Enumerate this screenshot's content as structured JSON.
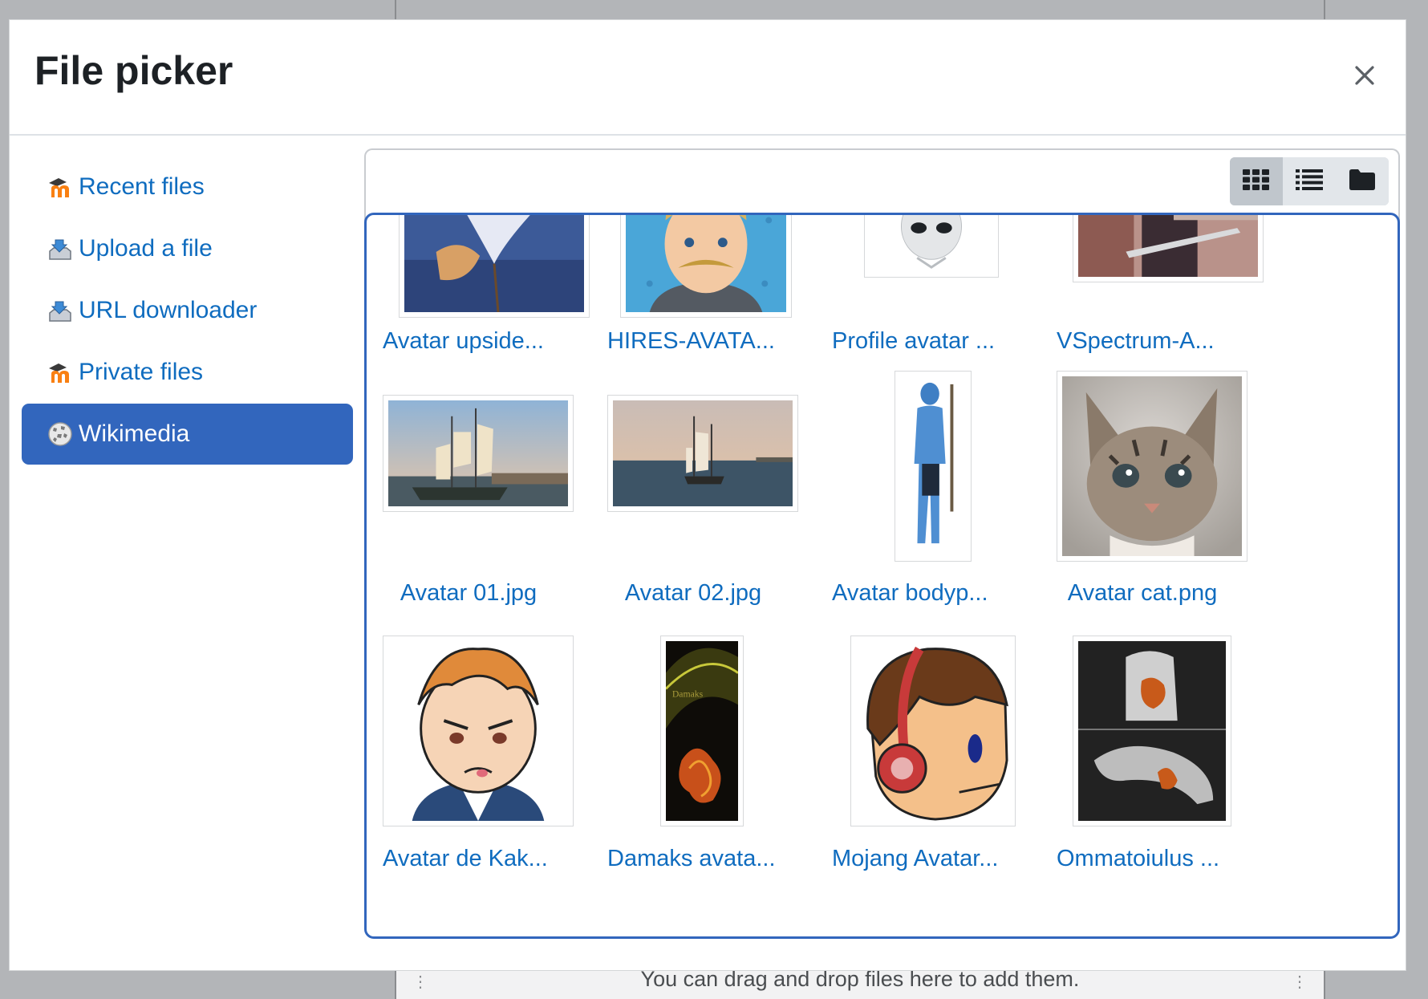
{
  "dialog": {
    "title": "File picker",
    "close_icon": "close-icon"
  },
  "sidebar": {
    "items": [
      {
        "label": "Recent files",
        "icon": "moodle-icon",
        "active": false
      },
      {
        "label": "Upload a file",
        "icon": "upload-icon",
        "active": false
      },
      {
        "label": "URL downloader",
        "icon": "download-icon",
        "active": false
      },
      {
        "label": "Private files",
        "icon": "moodle-icon",
        "active": false
      },
      {
        "label": "Wikimedia",
        "icon": "wikimedia-icon",
        "active": true
      }
    ]
  },
  "view_modes": [
    {
      "icon": "grid-view-icon",
      "active": true
    },
    {
      "icon": "list-view-icon",
      "active": false
    },
    {
      "icon": "folder-view-icon",
      "active": false
    }
  ],
  "files": [
    {
      "label": "Avatar upside...",
      "thumb": "flower"
    },
    {
      "label": "HIRES-AVATA...",
      "thumb": "cartoon-face"
    },
    {
      "label": "Profile avatar ...",
      "thumb": "alien"
    },
    {
      "label": "VSpectrum-A...",
      "thumb": "guitarist"
    },
    {
      "label": "Avatar 01.jpg",
      "thumb": "ship"
    },
    {
      "label": "Avatar 02.jpg",
      "thumb": "ship-sea"
    },
    {
      "label": "Avatar bodyp...",
      "thumb": "blue-figure"
    },
    {
      "label": "Avatar cat.png",
      "thumb": "kitten"
    },
    {
      "label": "Avatar de Kak...",
      "thumb": "cartoon-boy"
    },
    {
      "label": "Damaks avata...",
      "thumb": "dark-art"
    },
    {
      "label": "Mojang Avatar...",
      "thumb": "headphones"
    },
    {
      "label": "Ommatoiulus ...",
      "thumb": "xray"
    }
  ],
  "background": {
    "dropzone_text": "You can drag and drop files here to add them."
  },
  "colors": {
    "accent": "#3266bd",
    "link": "#0f6cbf"
  }
}
